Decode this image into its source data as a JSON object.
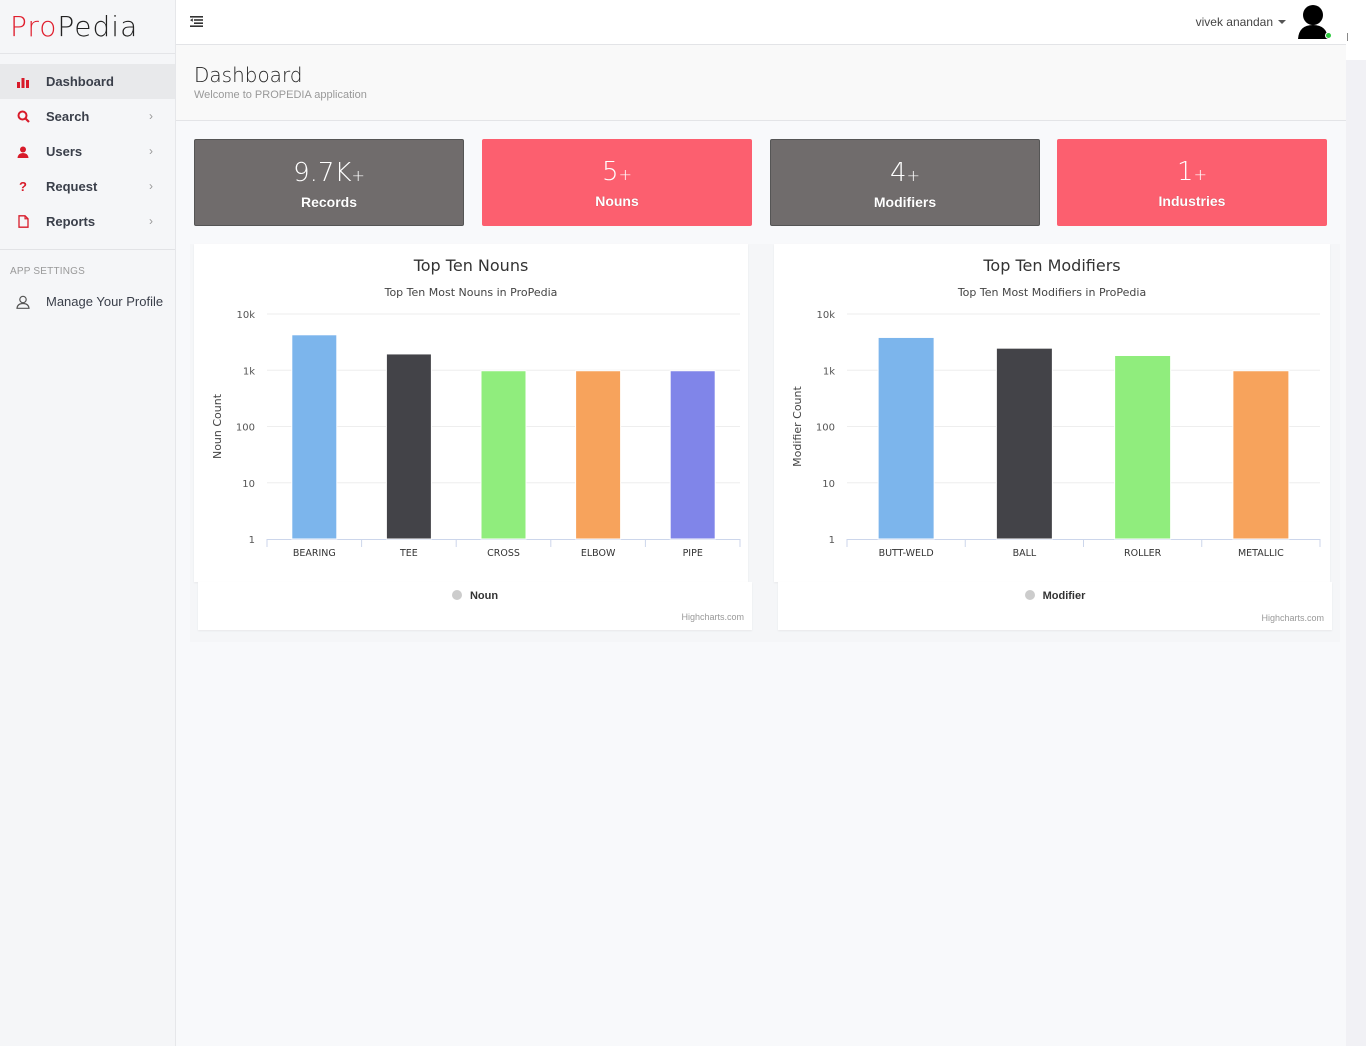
{
  "brand": {
    "logo_part1": "Pro",
    "logo_part2": "Pedia",
    "accent": "#e01e2d"
  },
  "sidebar": {
    "items": [
      {
        "label": "Dashboard",
        "icon": "bar-chart-icon",
        "active": true,
        "has_chevron": false
      },
      {
        "label": "Search",
        "icon": "search-icon",
        "active": false,
        "has_chevron": true
      },
      {
        "label": "Users",
        "icon": "user-icon",
        "active": false,
        "has_chevron": true
      },
      {
        "label": "Request",
        "icon": "question-icon",
        "active": false,
        "has_chevron": true
      },
      {
        "label": "Reports",
        "icon": "file-icon",
        "active": false,
        "has_chevron": true
      }
    ],
    "section_label": "APP SETTINGS",
    "settings_items": [
      {
        "label": "Manage Your Profile",
        "icon": "user-outline-icon"
      }
    ],
    "chevron": "›"
  },
  "topbar": {
    "menu_icon": "menu-collapse-icon",
    "user_name": "vivek anandan",
    "avatar_icon": "user-avatar-icon",
    "status": "online"
  },
  "page": {
    "title": "Dashboard",
    "subtitle": "Welcome to PROPEDIA application"
  },
  "stats": [
    {
      "value": "9.7K",
      "suffix": "+",
      "label": "Records",
      "color": "#706c6c"
    },
    {
      "value": "5",
      "suffix": "+",
      "label": "Nouns",
      "color": "#fc5f6f"
    },
    {
      "value": "4",
      "suffix": "+",
      "label": "Modifiers",
      "color": "#706c6c"
    },
    {
      "value": "1",
      "suffix": "+",
      "label": "Industries",
      "color": "#fc5f6f"
    }
  ],
  "chart_data": [
    {
      "type": "bar",
      "title": "Top Ten Nouns",
      "subtitle": "Top Ten Most Nouns in ProPedia",
      "xlabel": "",
      "ylabel": "Noun Count",
      "yscale": "log",
      "ylim": [
        1,
        10000
      ],
      "yticks": [
        "1",
        "10",
        "100",
        "1k",
        "10k"
      ],
      "grid": true,
      "categories": [
        "BEARING",
        "TEE",
        "CROSS",
        "ELBOW",
        "PIPE"
      ],
      "values": [
        4270,
        1950,
        980,
        980,
        980
      ],
      "colors": [
        "#7cb5ec",
        "#434348",
        "#90ed7d",
        "#f7a35c",
        "#8085e9"
      ],
      "legend": {
        "entries": [
          "Noun"
        ],
        "placement": "bottom-center"
      },
      "credits": "Highcharts.com"
    },
    {
      "type": "bar",
      "title": "Top Ten Modifiers",
      "subtitle": "Top Ten Most Modifiers in ProPedia",
      "xlabel": "",
      "ylabel": "Modifier Count",
      "yscale": "log",
      "ylim": [
        1,
        10000
      ],
      "yticks": [
        "1",
        "10",
        "100",
        "1k",
        "10k"
      ],
      "grid": true,
      "categories": [
        "BUTT-WELD",
        "BALL",
        "ROLLER",
        "METALLIC"
      ],
      "values": [
        3830,
        2470,
        1830,
        980
      ],
      "colors": [
        "#7cb5ec",
        "#434348",
        "#90ed7d",
        "#f7a35c"
      ],
      "legend": {
        "entries": [
          "Modifier"
        ],
        "placement": "bottom-center"
      },
      "credits": "Highcharts.com"
    }
  ]
}
